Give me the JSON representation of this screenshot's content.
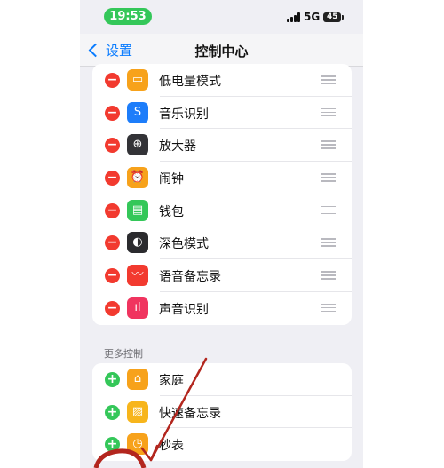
{
  "status_bar": {
    "time": "19:53",
    "network": "5G",
    "battery": "45"
  },
  "nav": {
    "back_label": "设置",
    "title": "控制中心"
  },
  "included_controls": [
    {
      "label": "低电量模式",
      "icon": "battery-icon",
      "icon_color": "#f7a21b",
      "glyph": "▭"
    },
    {
      "label": "音乐识别",
      "icon": "shazam-icon",
      "icon_color": "#1d7dfa",
      "glyph": "S"
    },
    {
      "label": "放大器",
      "icon": "magnifier-icon",
      "icon_color": "#333337",
      "glyph": "⊕"
    },
    {
      "label": "闹钟",
      "icon": "alarm-icon",
      "icon_color": "#f7a21b",
      "glyph": "⏰"
    },
    {
      "label": "钱包",
      "icon": "wallet-icon",
      "icon_color": "#34c759",
      "glyph": "▤"
    },
    {
      "label": "深色模式",
      "icon": "dark-mode-icon",
      "icon_color": "#2b2b2e",
      "glyph": "◐"
    },
    {
      "label": "语音备忘录",
      "icon": "voice-memo-icon",
      "icon_color": "#f23a2f",
      "glyph": "〰"
    },
    {
      "label": "声音识别",
      "icon": "sound-recognition-icon",
      "icon_color": "#f0345f",
      "glyph": "ıl"
    }
  ],
  "more_controls": {
    "header": "更多控制",
    "items": [
      {
        "label": "家庭",
        "icon": "home-icon",
        "icon_color": "#f7a21b",
        "glyph": "⌂"
      },
      {
        "label": "快速备忘录",
        "icon": "quick-note-icon",
        "icon_color": "#f7b51b",
        "glyph": "▨"
      },
      {
        "label": "秒表",
        "icon": "stopwatch-icon",
        "icon_color": "#f7a21b",
        "glyph": "◷"
      }
    ]
  },
  "colors": {
    "accent": "#0a7cff",
    "remove": "#f23a2f",
    "add": "#34c759",
    "annotation": "#b3261e"
  }
}
